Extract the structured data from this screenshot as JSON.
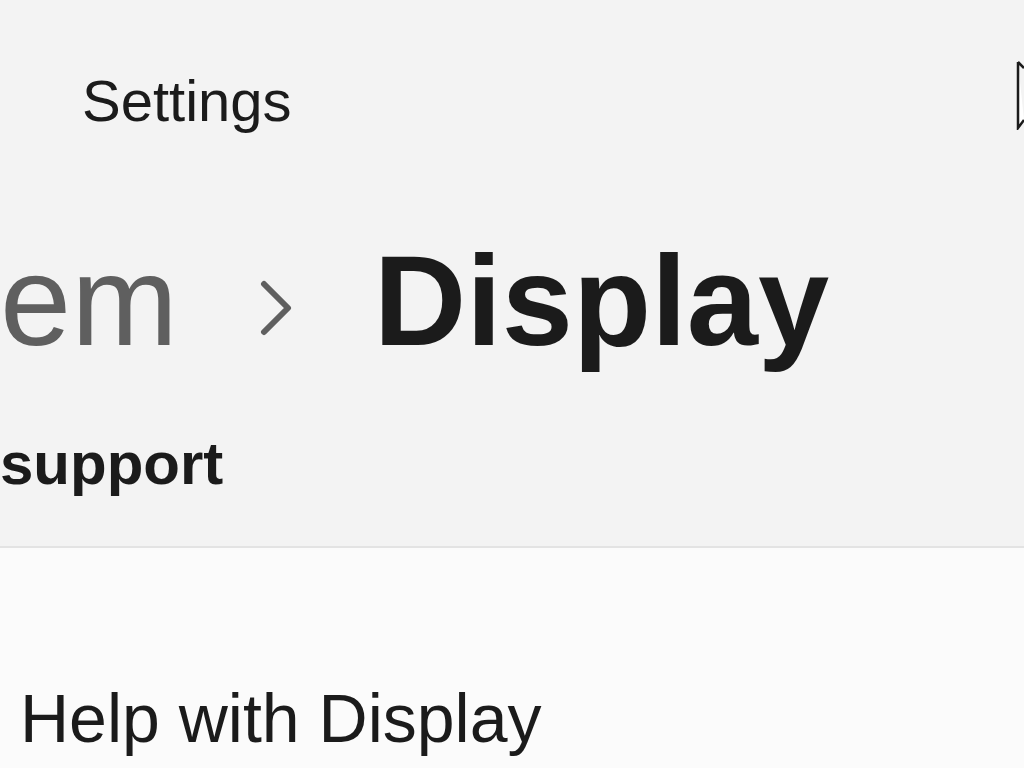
{
  "window": {
    "title": "Settings"
  },
  "breadcrumb": [
    {
      "label": "em",
      "current": false
    },
    {
      "label": "Display",
      "current": true
    }
  ],
  "section_heading": "support",
  "help_item": {
    "label": "Help with Display"
  }
}
